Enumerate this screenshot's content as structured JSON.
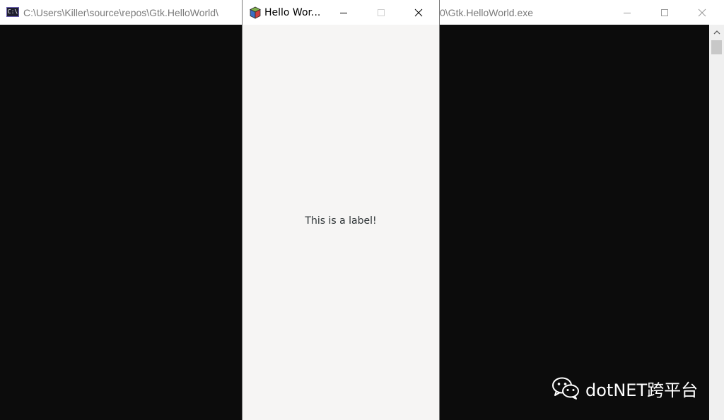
{
  "console_window": {
    "title_left": "C:\\Users\\Killer\\source\\repos\\Gtk.HelloWorld\\",
    "title_right": "0\\Gtk.HelloWorld.exe",
    "icon_text": "C:\\"
  },
  "gtk_window": {
    "title": "Hello Wor...",
    "label": "This is a label!"
  },
  "watermark": {
    "text": "dotNET跨平台"
  },
  "colors": {
    "console_bg": "#0c0c0c",
    "gtk_bg": "#f6f5f4",
    "titlebar_bg": "#ffffff"
  }
}
